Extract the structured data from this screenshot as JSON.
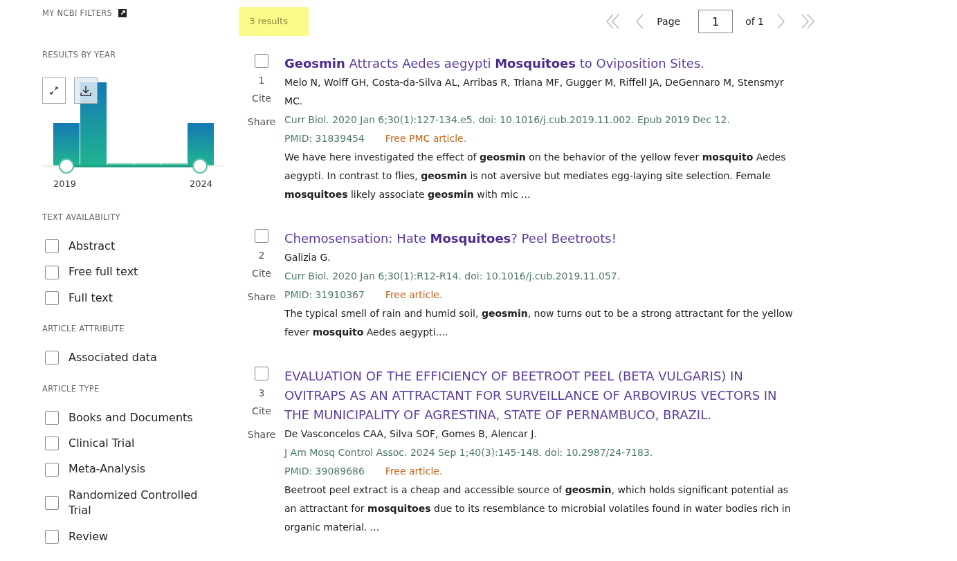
{
  "sidebar": {
    "my_filters": {
      "label": "MY NCBI FILTERS"
    },
    "results_by_year": {
      "heading": "RESULTS BY YEAR",
      "range_start": "2019",
      "range_end": "2024"
    },
    "sections": [
      {
        "heading": "TEXT AVAILABILITY",
        "options": [
          {
            "label": "Abstract",
            "checked": false
          },
          {
            "label": "Free full text",
            "checked": false
          },
          {
            "label": "Full text",
            "checked": false
          }
        ]
      },
      {
        "heading": "ARTICLE ATTRIBUTE",
        "options": [
          {
            "label": "Associated data",
            "checked": false
          }
        ]
      },
      {
        "heading": "ARTICLE TYPE",
        "options": [
          {
            "label": "Books and Documents",
            "checked": false
          },
          {
            "label": "Clinical Trial",
            "checked": false
          },
          {
            "label": "Meta-Analysis",
            "checked": false
          },
          {
            "label": "Randomized Controlled Trial",
            "checked": false
          },
          {
            "label": "Review",
            "checked": false
          }
        ]
      }
    ]
  },
  "results_count": "3 results",
  "pagination": {
    "page_label": "Page",
    "page_value": "1",
    "of_label": "of 1"
  },
  "results": [
    {
      "number": "1",
      "checked": false,
      "cite": "Cite",
      "share": "Share",
      "title": "**Geosmin** Attracts Aedes aegypti **Mosquitoes** to Oviposition Sites.",
      "authors": "Melo N, Wolff GH, Costa-da-Silva AL, Arribas R, Triana MF, Gugger M, Riffell JA, DeGennaro M, Stensmyr MC.",
      "citation": "Curr Biol. 2020 Jan 6;30(1):127-134.e5. doi: 10.1016/j.cub.2019.11.002. Epub 2019 Dec 12.",
      "pmid": "PMID: 31839454",
      "free": "Free PMC article.",
      "snippet": "We have here investigated the effect of **geosmin** on the behavior of the yellow fever **mosquito** Aedes aegypti. In contrast to flies, **geosmin** is not aversive but mediates egg-laying site selection. Female **mosquitoes** likely associate **geosmin** with mic ..."
    },
    {
      "number": "2",
      "checked": false,
      "cite": "Cite",
      "share": "Share",
      "title": "Chemosensation: Hate **Mosquitoes**? Peel Beetroots!",
      "authors": "Galizia G.",
      "citation": "Curr Biol. 2020 Jan 6;30(1):R12-R14. doi: 10.1016/j.cub.2019.11.057.",
      "pmid": "PMID: 31910367",
      "free": "Free article.",
      "snippet": "The typical smell of rain and humid soil, **geosmin**, now turns out to be a strong attractant for the yellow fever **mosquito** Aedes aegypti...."
    },
    {
      "number": "3",
      "checked": false,
      "cite": "Cite",
      "share": "Share",
      "title": "EVALUATION OF THE EFFICIENCY OF BEETROOT PEEL (BETA VULGARIS) IN OVITRAPS AS AN ATTRACTANT FOR SURVEILLANCE OF ARBOVIRUS VECTORS IN THE MUNICIPALITY OF AGRESTINA, STATE OF PERNAMBUCO, BRAZIL.",
      "authors": "De Vasconcelos CAA, Silva SOF, Gomes B, Alencar J.",
      "citation": "J Am Mosq Control Assoc. 2024 Sep 1;40(3):145-148. doi: 10.2987/24-7183.",
      "pmid": "PMID: 39089686",
      "free": "Free article.",
      "snippet": "Beetroot peel extract is a cheap and accessible source of **geosmin**, which holds significant potential as an attractant for **mosquitoes** due to its resemblance to microbial volatiles found in water bodies rich in organic material. ..."
    }
  ]
}
